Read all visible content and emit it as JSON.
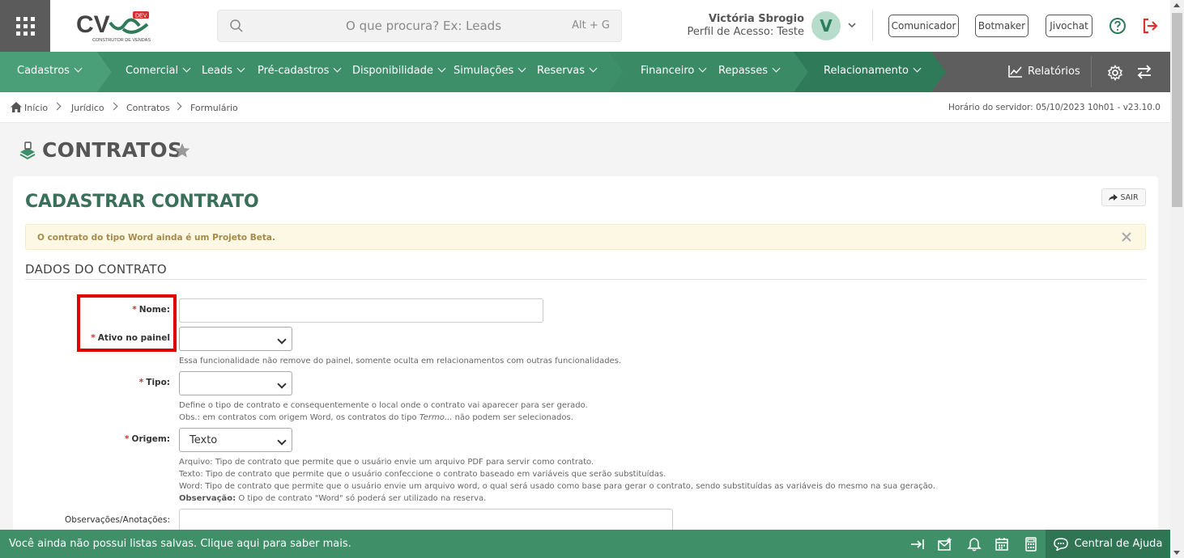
{
  "header": {
    "logo_text": "CV",
    "logo_badge": "DEV",
    "logo_tagline": "CONSTRUTOR DE VENDAS",
    "search_placeholder": "O que procura? Ex: Leads",
    "search_shortcut": "Alt + G",
    "user_name": "Victória Sbrogio",
    "user_profile": "Perfil de Acesso: Teste",
    "avatar_initial": "V",
    "buttons": [
      "Comunicador",
      "Botmaker",
      "Jivochat"
    ]
  },
  "nav": {
    "items": [
      "Cadastros",
      "Comercial",
      "Leads",
      "Pré-cadastros",
      "Disponibilidade",
      "Simulações",
      "Reservas",
      "Financeiro",
      "Repasses",
      "Relacionamento"
    ],
    "reports": "Relatórios",
    "colors": {
      "green_light": "#4a9e78",
      "green_mid": "#3d8f6a",
      "green_dark": "#2f7a58"
    }
  },
  "breadcrumb": {
    "items": [
      "Início",
      "Jurídico",
      "Contratos",
      "Formulário"
    ],
    "server_time": "Horário do servidor: 05/10/2023 10h01 - v23.10.0"
  },
  "page": {
    "title": "CONTRATOS",
    "card_title": "CADASTRAR CONTRATO",
    "exit_label": "SAIR",
    "alert": "O contrato do tipo Word ainda é um Projeto Beta.",
    "section": "DADOS DO CONTRATO"
  },
  "form": {
    "nome_label": "Nome:",
    "ativo_label": "Ativo no painel",
    "ativo_help": "Essa funcionalidade não remove do painel, somente oculta em relacionamentos com outras funcionalidades.",
    "tipo_label": "Tipo:",
    "tipo_help_1": "Define o tipo de contrato e consequentemente o local onde o contrato vai aparecer para ser gerado.",
    "tipo_help_2a": "Obs.: em contratos com origem Word, os contratos do tipo ",
    "tipo_help_2b": "Termo...",
    "tipo_help_2c": " não podem ser selecionados.",
    "origem_label": "Origem:",
    "origem_value": "Texto",
    "origem_help_1": "Arquivo: Tipo de contrato que permite que o usuário envie um arquivo PDF para servir como contrato.",
    "origem_help_2": "Texto: Tipo de contrato que permite que o usuário confeccione o contrato baseado em variáveis que serão substituídas.",
    "origem_help_3": "Word: Tipo de contrato que permite que o usuário envie um arquivo word, o qual será usado como base para gerar o contrato, sendo substituídas as variáveis do mesmo na sua geração.",
    "origem_help_4a": "Observação:",
    "origem_help_4b": " O tipo de contrato \"Word\" só poderá ser utilizado na reserva.",
    "obs_label": "Observações/Anotações:",
    "required_mark": "*"
  },
  "footer": {
    "message": "Você ainda não possui listas salvas. Clique aqui para saber mais.",
    "help_center": "Central de Ajuda"
  }
}
